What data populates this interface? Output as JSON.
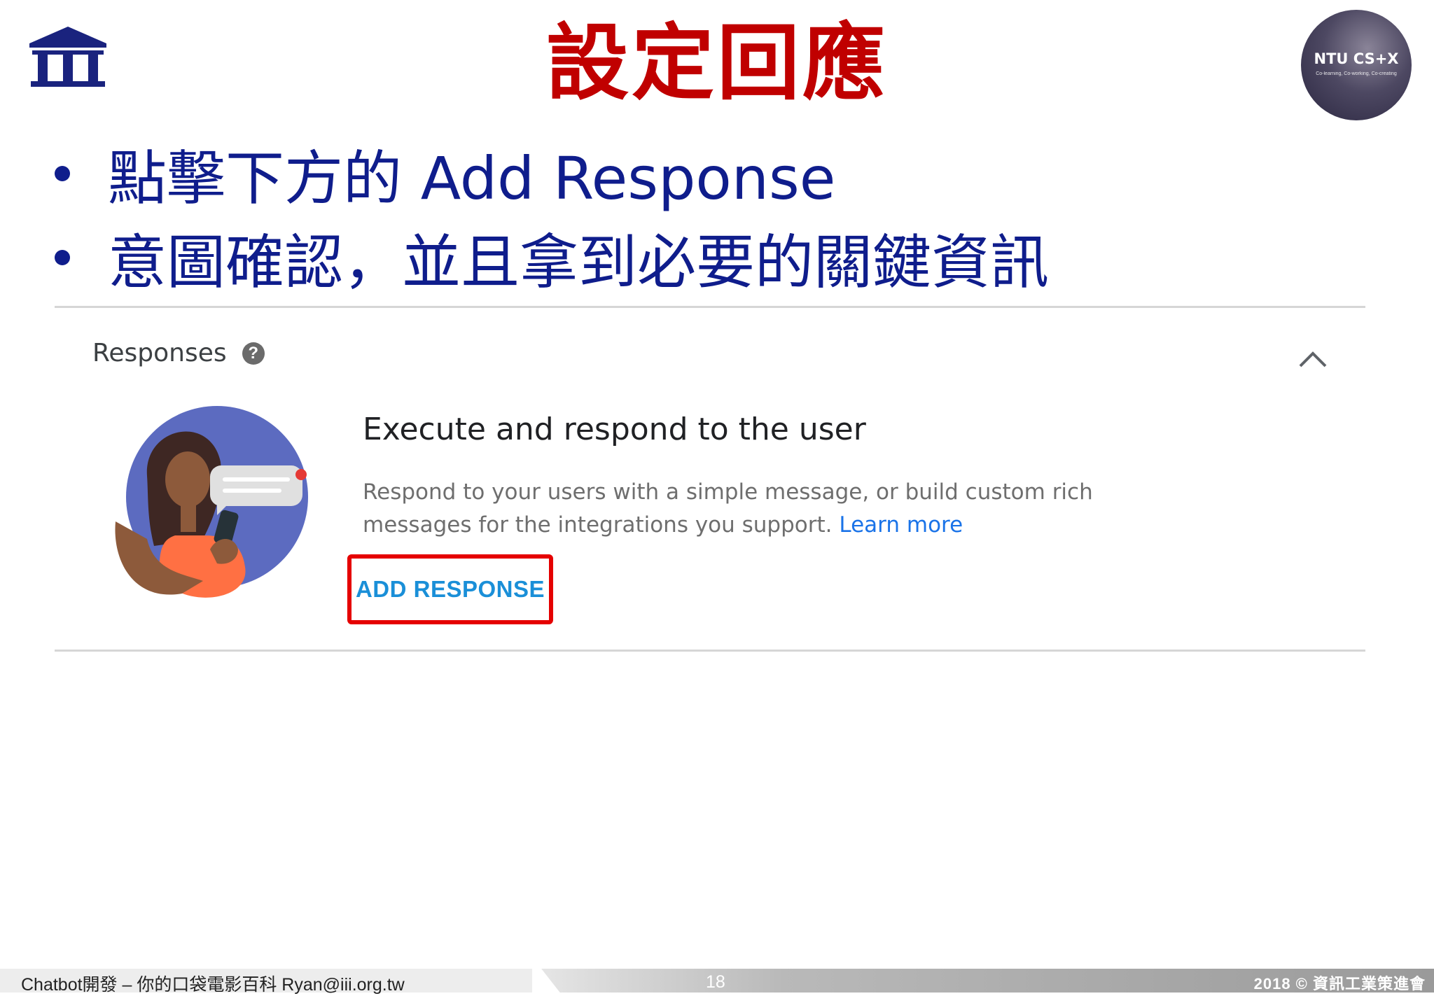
{
  "slide": {
    "title": "設定回應",
    "bullets": [
      "點擊下方的 Add Response",
      "意圖確認，並且拿到必要的關鍵資訊"
    ]
  },
  "badge": {
    "text": "NTU CS+X",
    "subtext": "Co-learning, Co-working, Co-creating"
  },
  "logo": {
    "icon": "iii-building-logo"
  },
  "responses_panel": {
    "label": "Responses",
    "help_icon": "help-circle-icon",
    "collapse_icon": "chevron-up-icon",
    "card_title": "Execute and respond to the user",
    "card_description": "Respond to your users with a simple message, or build custom rich messages for the integrations you support.",
    "learn_more": "Learn more",
    "add_response": "ADD RESPONSE"
  },
  "footer": {
    "left": "Chatbot開發 – 你的口袋電影百科 Ryan@iii.org.tw",
    "page": "18",
    "right": "2018 © 資訊工業策進會"
  },
  "colors": {
    "title": "#c00000",
    "bullet_text": "#0f1d8c",
    "link": "#1a73e8",
    "add_response": "#1a8fd8",
    "highlight_box": "#e50000"
  }
}
